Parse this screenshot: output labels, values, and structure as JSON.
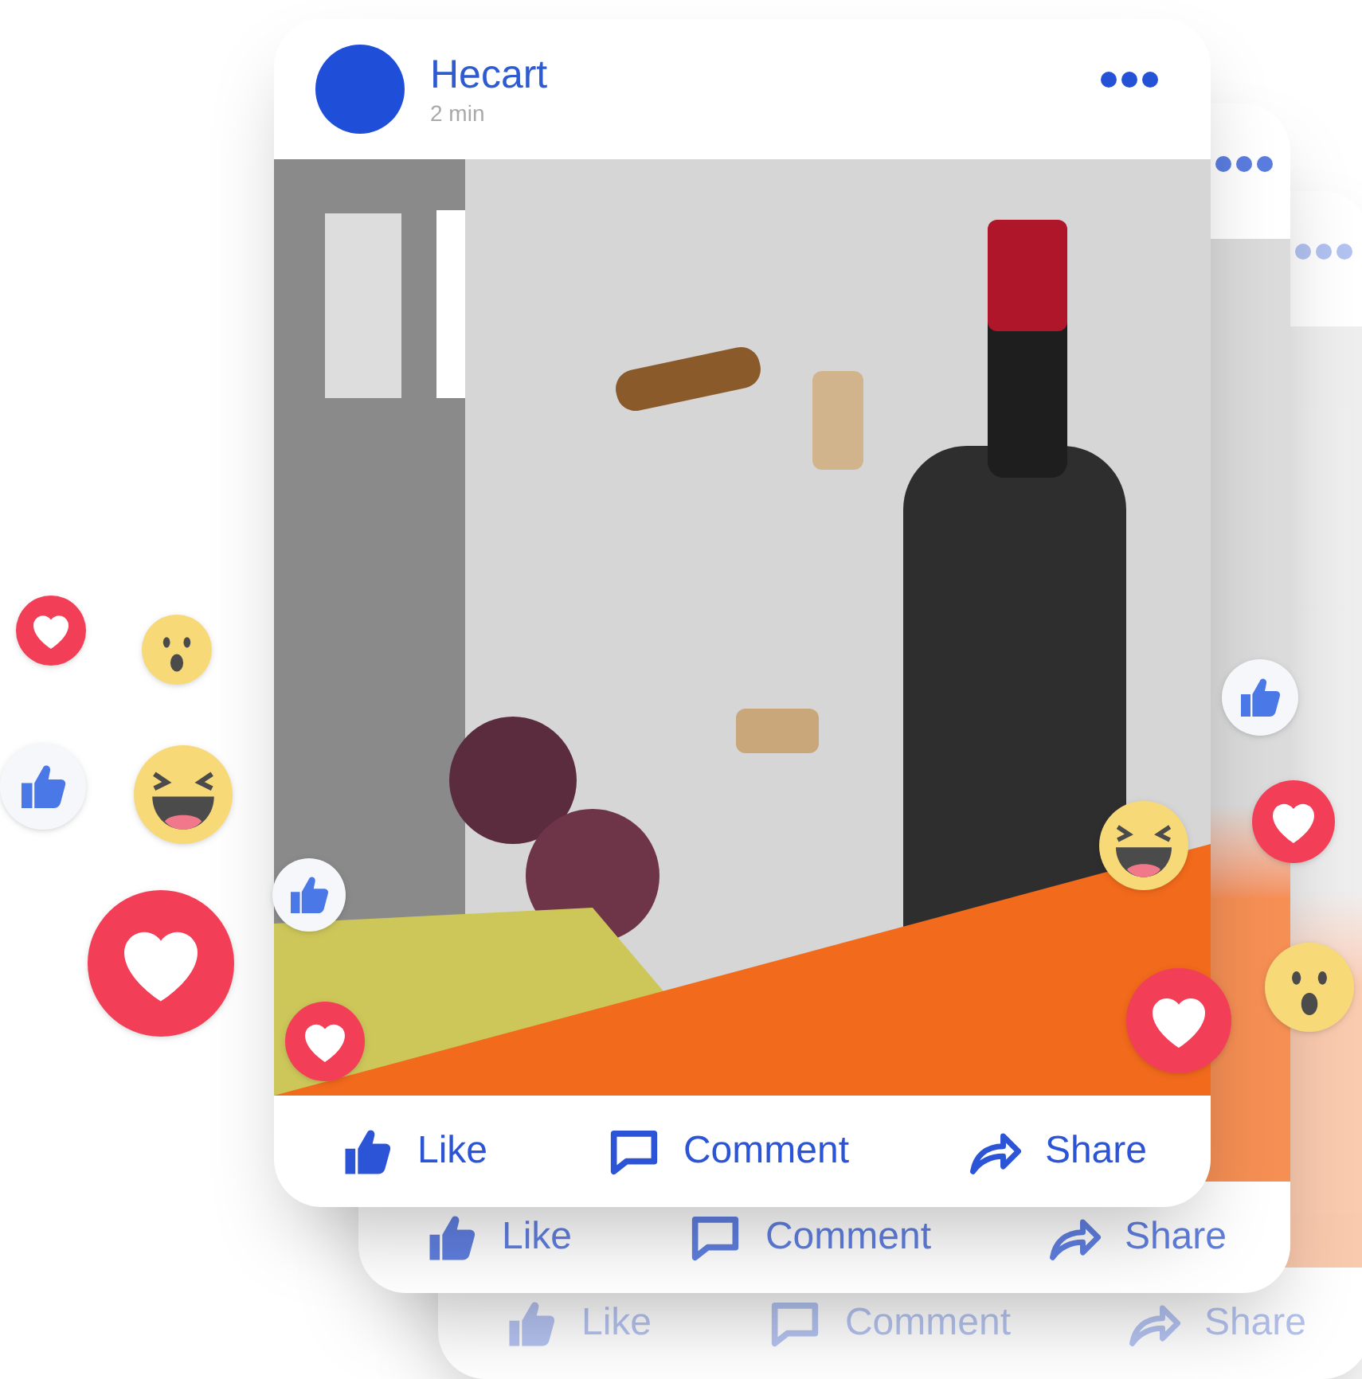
{
  "post": {
    "author": "Hecart",
    "time": "2 min",
    "actions": [
      {
        "kind": "like",
        "label": "Like"
      },
      {
        "kind": "comment",
        "label": "Comment"
      },
      {
        "kind": "share",
        "label": "Share"
      }
    ]
  },
  "stacked_posts": [
    {
      "actions": [
        {
          "kind": "like",
          "label": "Like"
        },
        {
          "kind": "comment",
          "label": "Comment"
        },
        {
          "kind": "share",
          "label": "Share"
        }
      ]
    },
    {
      "actions": [
        {
          "kind": "like",
          "label": "Like"
        },
        {
          "kind": "comment",
          "label": "Comment"
        },
        {
          "kind": "share",
          "label": "Share"
        }
      ]
    }
  ],
  "reactions": [
    {
      "kind": "heart"
    },
    {
      "kind": "wow"
    },
    {
      "kind": "like"
    },
    {
      "kind": "haha"
    },
    {
      "kind": "heart"
    },
    {
      "kind": "like"
    },
    {
      "kind": "heart"
    },
    {
      "kind": "haha"
    },
    {
      "kind": "heart"
    },
    {
      "kind": "like"
    },
    {
      "kind": "heart"
    },
    {
      "kind": "wow"
    }
  ]
}
